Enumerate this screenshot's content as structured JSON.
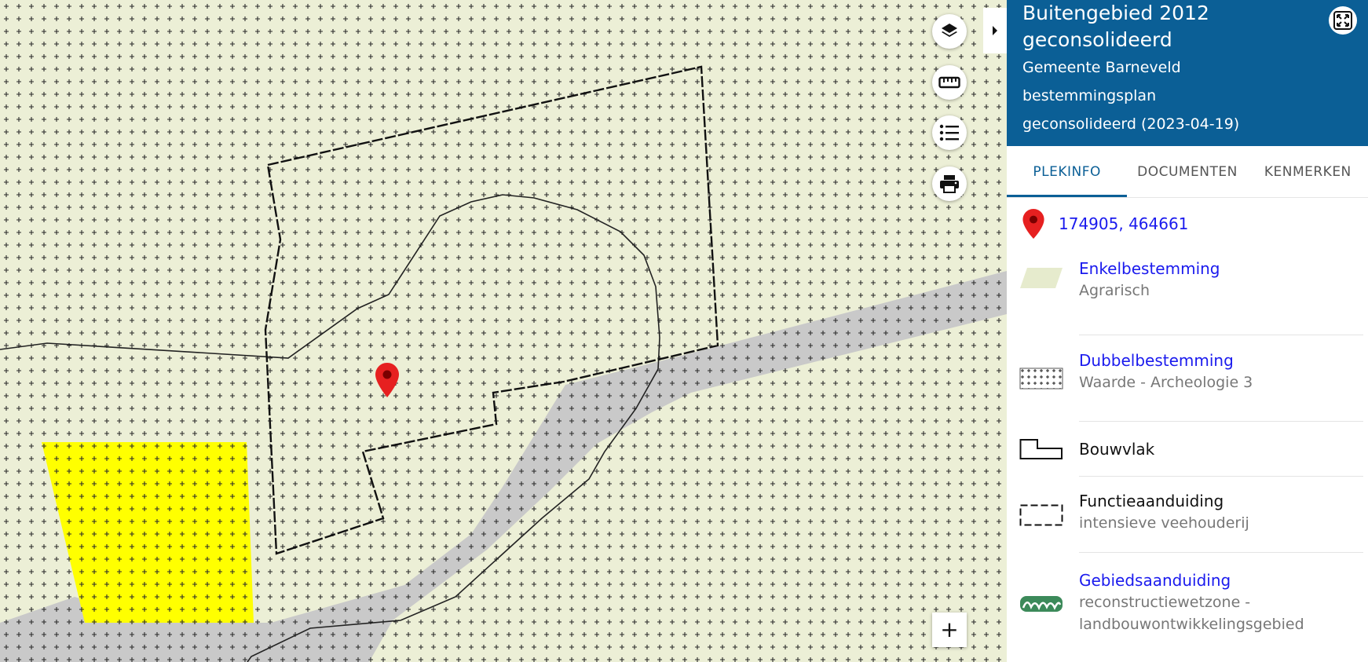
{
  "panel": {
    "title": "Buitengebied 2012 geconsolideerd",
    "municipality": "Gemeente Barneveld",
    "plan_type": "bestemmingsplan",
    "status": "geconsolideerd (2023-04-19)",
    "fullscreen_icon": "fullscreen-icon",
    "header_color": "#0b5f96"
  },
  "tabs": [
    {
      "label": "PLEKINFO",
      "active": true
    },
    {
      "label": "DOCUMENTEN",
      "active": false
    },
    {
      "label": "KENMERKEN",
      "active": false
    }
  ],
  "location": {
    "icon": "map-pin-icon",
    "coordinates": "174905, 464661"
  },
  "legend": [
    {
      "symbol": "enkelbestemming-swatch",
      "title": "Enkelbestemming",
      "subtitle": "Agrarisch",
      "link": true
    },
    {
      "symbol": "dubbelbestemming-swatch",
      "title": "Dubbelbestemming",
      "subtitle": "Waarde - Archeologie 3",
      "link": true
    },
    {
      "symbol": "bouwvlak-swatch",
      "title": "Bouwvlak",
      "subtitle": "",
      "link": false
    },
    {
      "symbol": "functieaanduiding-swatch",
      "title": "Functieaanduiding",
      "subtitle": "intensieve veehouderij",
      "link": false
    },
    {
      "symbol": "gebiedsaanduiding-swatch",
      "title": "Gebiedsaanduiding",
      "subtitle": "reconstructiewetzone - landbouwontwikkelingsgebied",
      "link": true
    }
  ],
  "map_controls": {
    "layers": "layers-icon",
    "measure": "ruler-icon",
    "legend": "list-icon",
    "print": "printer-icon",
    "zoom_in": "+",
    "collapse": "chevron-right-icon"
  },
  "colors": {
    "agrarisch": "#ecefd6",
    "road": "#c9c9c9",
    "yellow_zone": "#ffff00",
    "link": "#1a1aee",
    "marker": "#e62020"
  }
}
